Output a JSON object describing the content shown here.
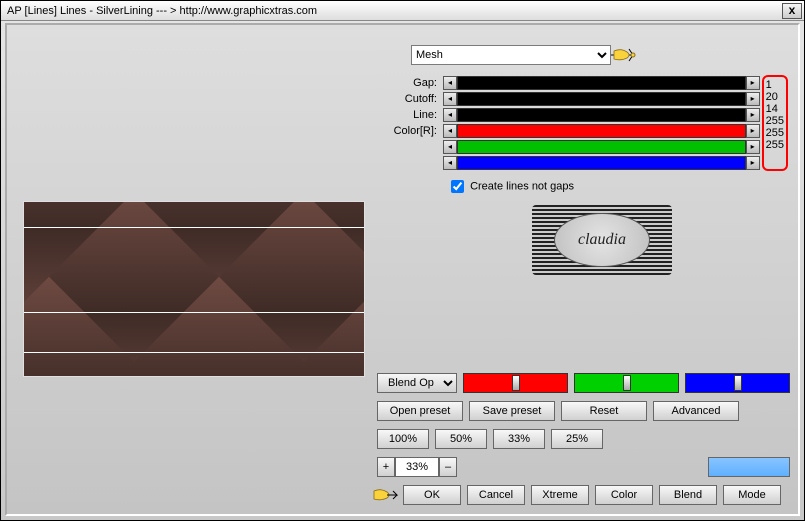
{
  "window": {
    "title": "AP [Lines]  Lines - SilverLining    --- >  http://www.graphicxtras.com",
    "close": "x"
  },
  "mesh": {
    "selected": "Mesh"
  },
  "sliders": {
    "gap": {
      "label": "Gap:",
      "value": "1"
    },
    "cutoff": {
      "label": "Cutoff:",
      "value": "20"
    },
    "line": {
      "label": "Line:",
      "value": "14"
    },
    "colorR": {
      "label": "Color[R]:",
      "value": "255"
    },
    "colorG": {
      "label": "",
      "value": "255"
    },
    "colorB": {
      "label": "",
      "value": "255"
    }
  },
  "checkbox": {
    "create_lines": "Create lines not gaps",
    "checked": true
  },
  "logo": {
    "text": "claudia"
  },
  "blend": {
    "selected": "Blend Opti"
  },
  "buttons": {
    "open_preset": "Open preset",
    "save_preset": "Save preset",
    "reset": "Reset",
    "advanced": "Advanced",
    "p100": "100%",
    "p50": "50%",
    "p33": "33%",
    "p25": "25%",
    "zoom_plus": "+",
    "zoom_val": "33%",
    "zoom_minus": "–",
    "ok": "OK",
    "cancel": "Cancel",
    "xtreme": "Xtreme",
    "color": "Color",
    "blend": "Blend",
    "mode": "Mode"
  }
}
